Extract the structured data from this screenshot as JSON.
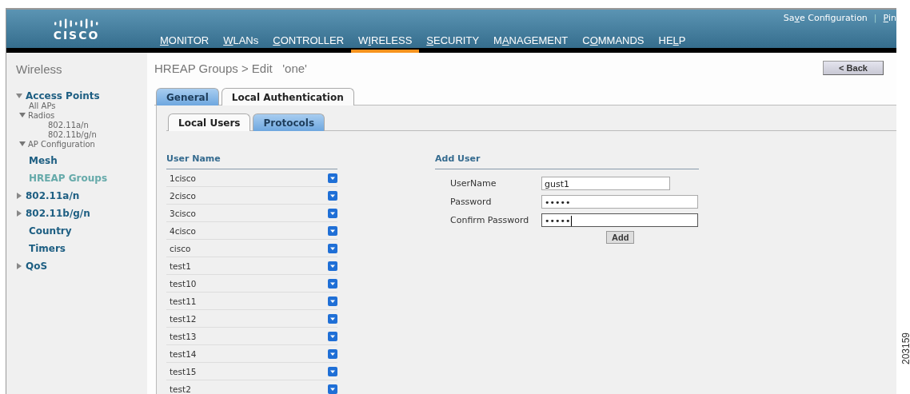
{
  "header": {
    "logo": "CISCO",
    "top_links": [
      {
        "pre": "Sa",
        "key": "v",
        "post": "e Configuration"
      },
      {
        "key": "P",
        "post": "in"
      }
    ],
    "top_link_separator": "|",
    "menu": [
      {
        "key": "M",
        "post": "ONITOR",
        "selected": false
      },
      {
        "key": "W",
        "post": "LANs",
        "selected": false
      },
      {
        "key": "C",
        "post": "ONTROLLER",
        "selected": false
      },
      {
        "pre": "W",
        "key": "I",
        "post": "RELESS",
        "selected": true
      },
      {
        "key": "S",
        "post": "ECURITY",
        "selected": false
      },
      {
        "pre": "M",
        "key": "A",
        "post": "NAGEMENT",
        "selected": false
      },
      {
        "pre": "C",
        "key": "O",
        "post": "MMANDS",
        "selected": false
      },
      {
        "pre": "HE",
        "key": "L",
        "post": "P",
        "selected": false
      }
    ]
  },
  "sidebar": {
    "title": "Wireless",
    "items": [
      {
        "label": "Access Points",
        "expanded": true,
        "selected": false,
        "children": [
          {
            "label": "All APs"
          },
          {
            "label": "Radios",
            "expanded": true,
            "children": [
              {
                "label": "802.11a/n"
              },
              {
                "label": "802.11b/g/n"
              }
            ]
          },
          {
            "label": "AP Configuration",
            "expanded": true
          }
        ]
      },
      {
        "label": "Mesh",
        "selected": false
      },
      {
        "label": "HREAP Groups",
        "selected": true
      },
      {
        "label": "802.11a/n",
        "expanded": false,
        "selected": false
      },
      {
        "label": "802.11b/g/n",
        "expanded": false,
        "selected": false
      },
      {
        "label": "Country",
        "selected": false
      },
      {
        "label": "Timers",
        "selected": false
      },
      {
        "label": "QoS",
        "expanded": false,
        "selected": false
      }
    ]
  },
  "page": {
    "title": "HREAP Groups > Edit   'one'",
    "back_button": "< Back",
    "tabs": [
      {
        "label": "General",
        "selected": false
      },
      {
        "label": "Local Authentication",
        "selected": true
      }
    ],
    "subtabs": [
      {
        "label": "Local Users",
        "selected": true
      },
      {
        "label": "Protocols",
        "selected": false
      }
    ],
    "users": {
      "heading": "User Name",
      "rows": [
        "1cisco",
        "2cisco",
        "3cisco",
        "4cisco",
        "cisco",
        "test1",
        "test10",
        "test11",
        "test12",
        "test13",
        "test14",
        "test15",
        "test2"
      ]
    },
    "add_user": {
      "heading": "Add User",
      "fields": [
        {
          "label": "UserName",
          "value": "gust1",
          "kind": "text",
          "focused": false
        },
        {
          "label": "Password",
          "value": "•••••",
          "kind": "password",
          "focused": false
        },
        {
          "label": "Confirm Password",
          "value": "•••••",
          "kind": "password",
          "focused": true
        }
      ],
      "button": "Add"
    }
  },
  "figure_id": "203159"
}
